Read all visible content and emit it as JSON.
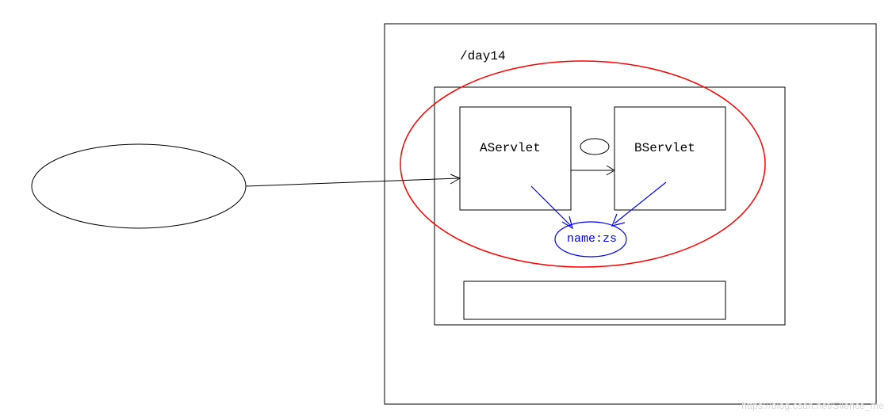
{
  "diagram": {
    "context_label": "/day14",
    "servlet_a": "AServlet",
    "servlet_b": "BServlet",
    "shared_data": "name:zs"
  },
  "watermark": "https://blog.csdn.net/Silence_me"
}
